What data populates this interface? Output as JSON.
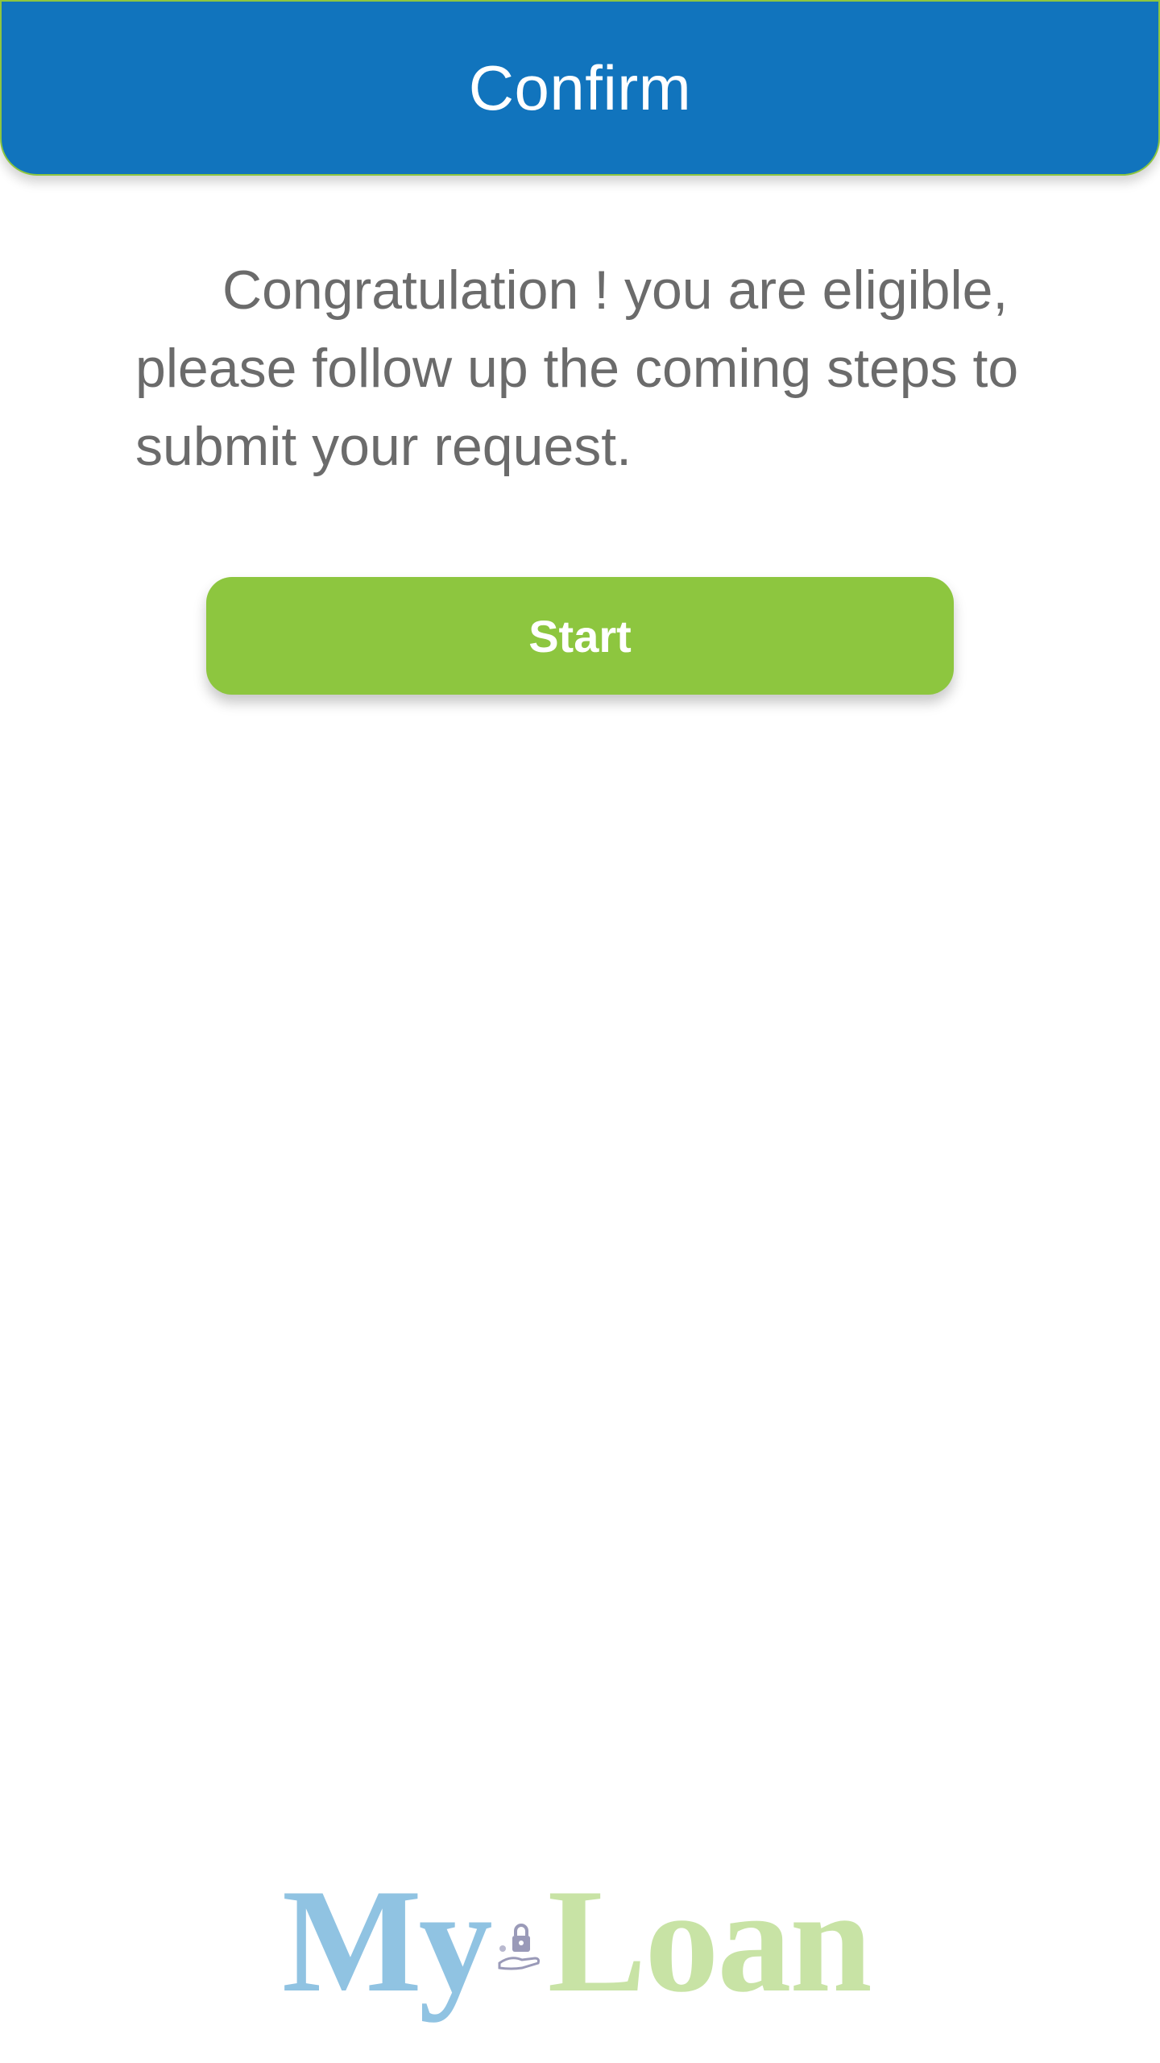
{
  "header": {
    "title": "Confirm"
  },
  "main": {
    "message": "Congratulation ! you are eligible, please follow up the coming steps to submit your request.",
    "start_label": "Start"
  },
  "logo": {
    "part1": "My",
    "part2": "Loan",
    "icon": "hand-lock-icon"
  },
  "colors": {
    "header_bg": "#1174bd",
    "accent_green": "#8dc63f",
    "text_gray": "#6b6b6b"
  }
}
